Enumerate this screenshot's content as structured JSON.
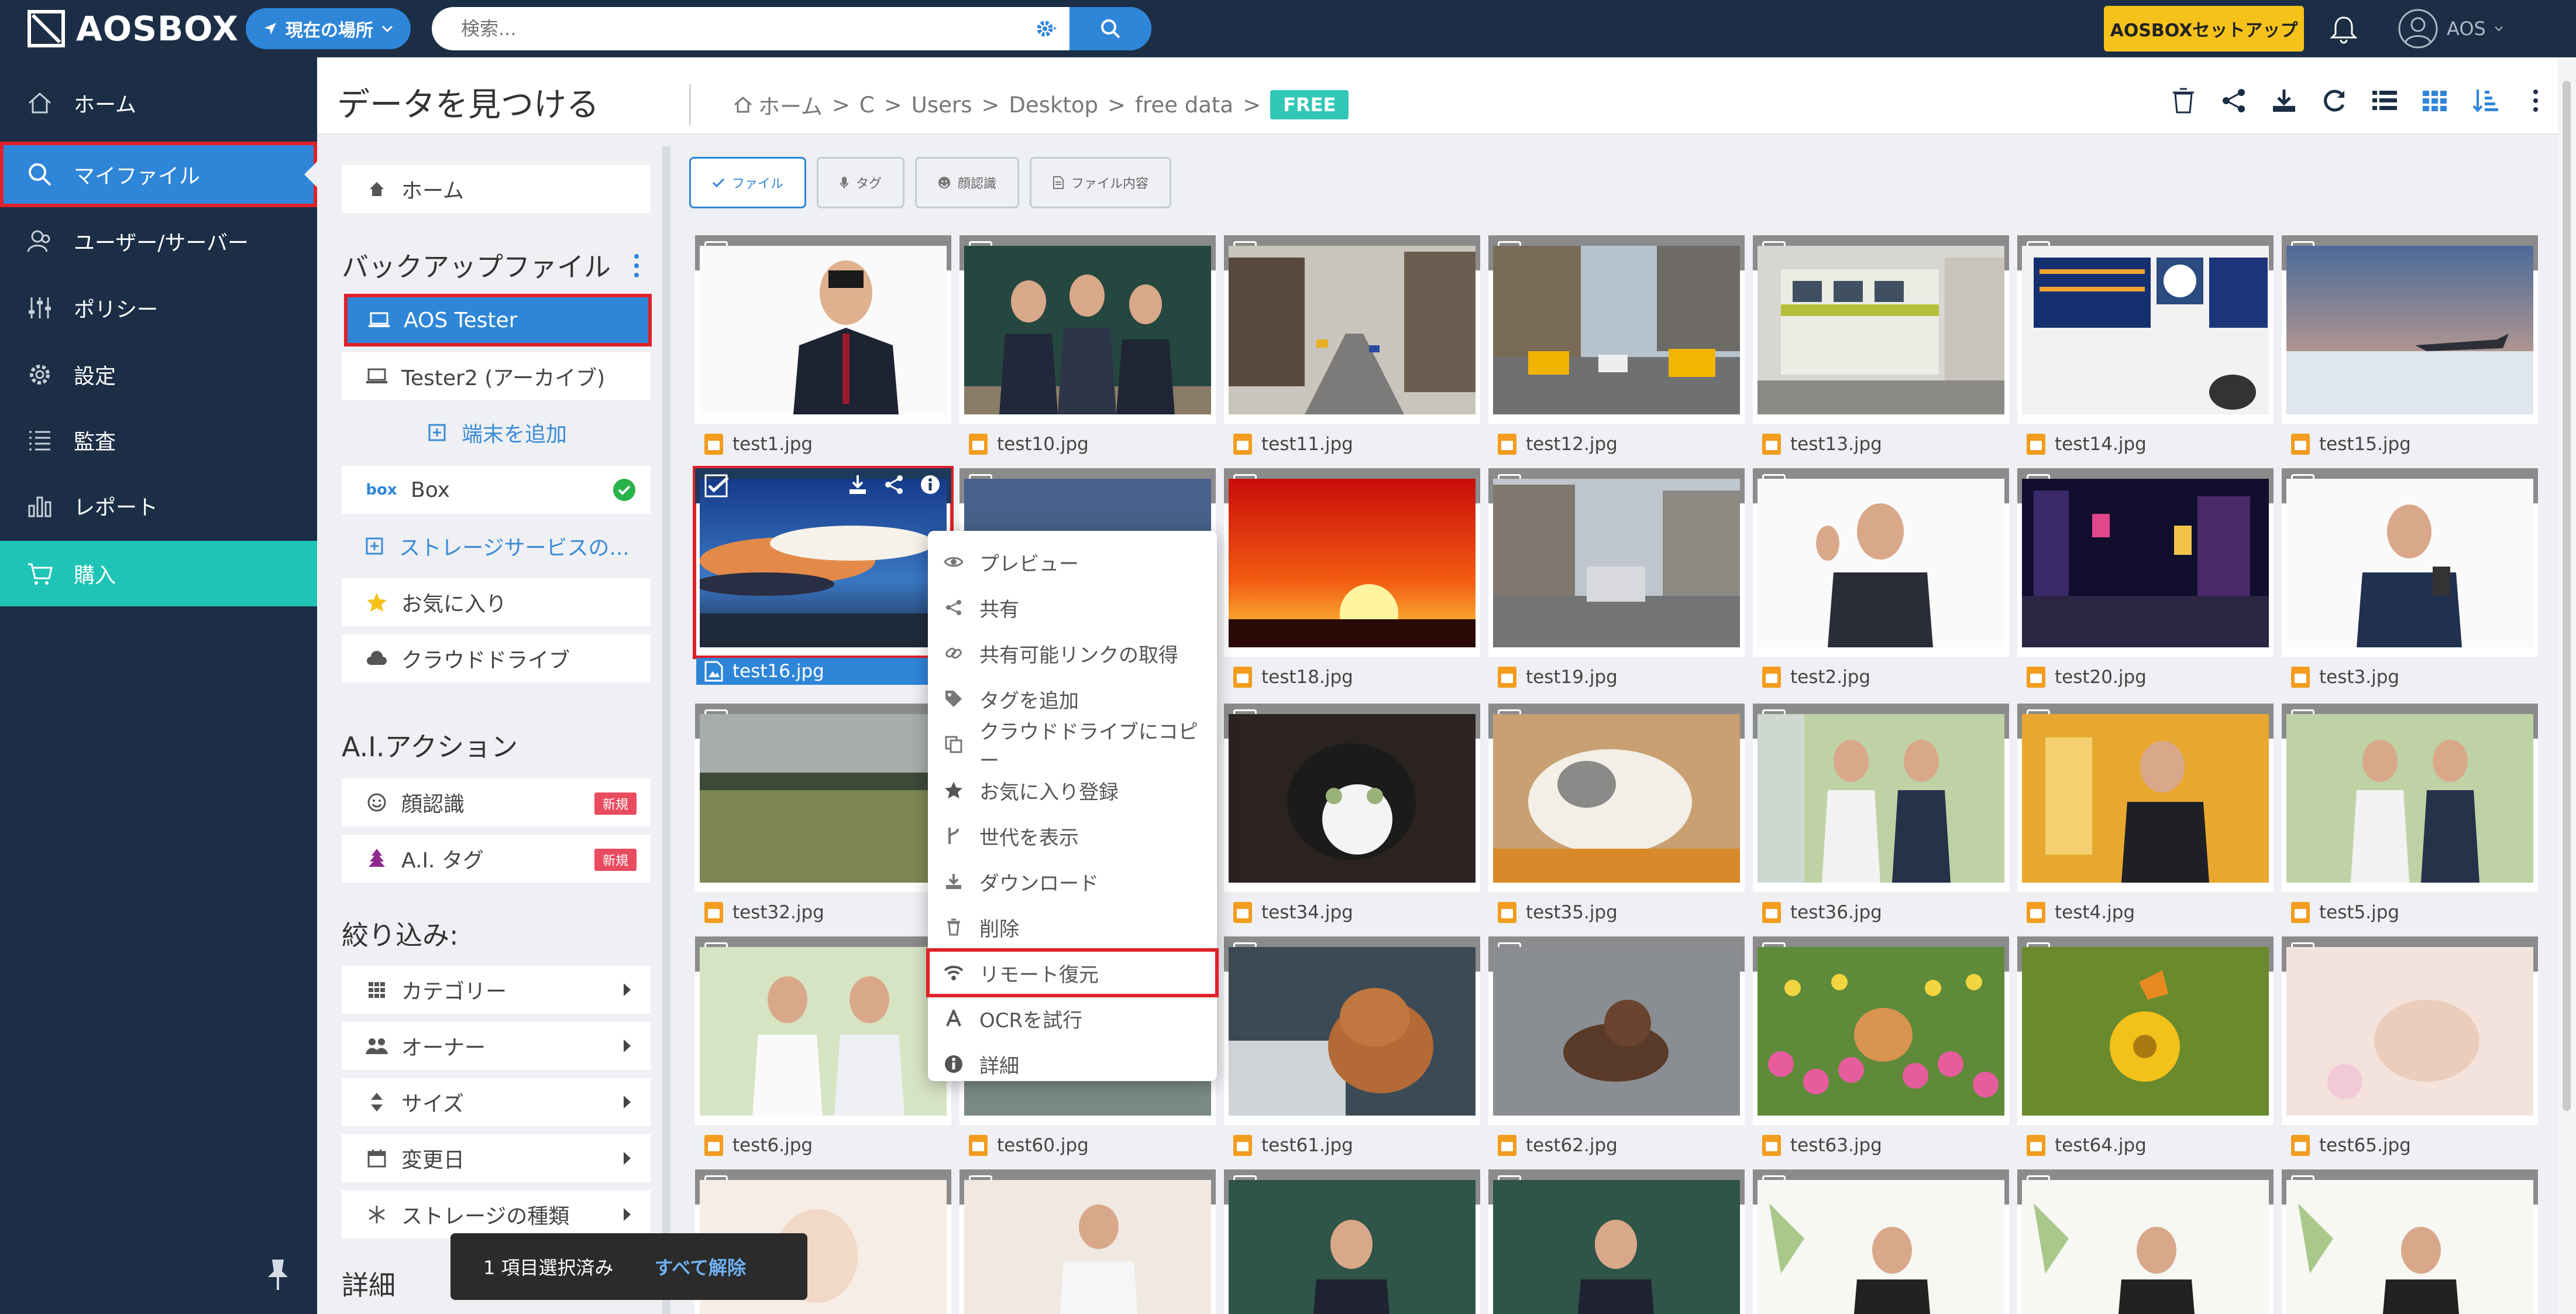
{
  "app": {
    "logo": "AOSBOX",
    "location_button": "現在の場所",
    "search_placeholder": "検索...",
    "setup_button": "AOSBOXセットアップ",
    "user_name": "AOS"
  },
  "nav": {
    "items": [
      {
        "label": "ホーム",
        "icon": "home-icon"
      },
      {
        "label": "マイファイル",
        "icon": "search-icon",
        "active": true
      },
      {
        "label": "ユーザー/サーバー",
        "icon": "users-icon"
      },
      {
        "label": "ポリシー",
        "icon": "sliders-icon"
      },
      {
        "label": "設定",
        "icon": "gear-icon"
      },
      {
        "label": "監査",
        "icon": "list-icon"
      },
      {
        "label": "レポート",
        "icon": "bar-chart-icon"
      },
      {
        "label": "購入",
        "icon": "cart-icon"
      }
    ]
  },
  "header": {
    "title": "データを見つける",
    "breadcrumb": [
      "ホーム",
      "C",
      "Users",
      "Desktop",
      "free data"
    ],
    "badge": "FREE"
  },
  "panel": {
    "home": "ホーム",
    "backup_title": "バックアップファイル",
    "devices": [
      "AOS Tester",
      "Tester2 (アーカイブ)"
    ],
    "add_device": "端末を追加",
    "box": "Box",
    "add_storage": "ストレージサービスの...",
    "favorites": "お気に入り",
    "cloud_drive": "クラウドドライブ",
    "ai_title": "A.I.アクション",
    "face": "顔認識",
    "ai_tag": "A.I. タグ",
    "new_badge": "新規",
    "filter_title": "絞り込み:",
    "filters": [
      "カテゴリー",
      "オーナー",
      "サイズ",
      "変更日",
      "ストレージの種類"
    ],
    "detail_title": "詳細"
  },
  "filter_buttons": [
    "ファイル",
    "タグ",
    "顔認識",
    "ファイル内容"
  ],
  "files": [
    "test1.jpg",
    "test10.jpg",
    "test11.jpg",
    "test12.jpg",
    "test13.jpg",
    "test14.jpg",
    "test15.jpg",
    "test16.jpg",
    "",
    "test18.jpg",
    "test19.jpg",
    "test2.jpg",
    "test20.jpg",
    "test3.jpg",
    "test32.jpg",
    "",
    "test34.jpg",
    "test35.jpg",
    "test36.jpg",
    "test4.jpg",
    "test5.jpg",
    "test6.jpg",
    "test60.jpg",
    "test61.jpg",
    "test62.jpg",
    "test63.jpg",
    "test64.jpg",
    "test65.jpg"
  ],
  "context_menu": [
    {
      "label": "プレビュー",
      "icon": "eye-icon"
    },
    {
      "label": "共有",
      "icon": "share-icon"
    },
    {
      "label": "共有可能リンクの取得",
      "icon": "link-icon"
    },
    {
      "label": "タグを追加",
      "icon": "tag-icon"
    },
    {
      "label": "クラウドドライブにコピー",
      "icon": "copy-icon"
    },
    {
      "label": "お気に入り登録",
      "icon": "star-icon"
    },
    {
      "label": "世代を表示",
      "icon": "branch-icon"
    },
    {
      "label": "ダウンロード",
      "icon": "download-icon"
    },
    {
      "label": "削除",
      "icon": "trash-icon"
    },
    {
      "label": "リモート復元",
      "icon": "wifi-icon",
      "highlighted": true
    },
    {
      "label": "OCRを試行",
      "icon": "font-icon"
    },
    {
      "label": "詳細",
      "icon": "info-icon"
    }
  ],
  "selection": {
    "count_text": "1 項目選択済み",
    "clear_text": "すべて解除"
  },
  "colors": {
    "nav_bg": "#1b2e45",
    "accent": "#2f86d8",
    "teal": "#1fc4b6",
    "highlight": "#e0202a",
    "setup": "#f4c21b"
  }
}
